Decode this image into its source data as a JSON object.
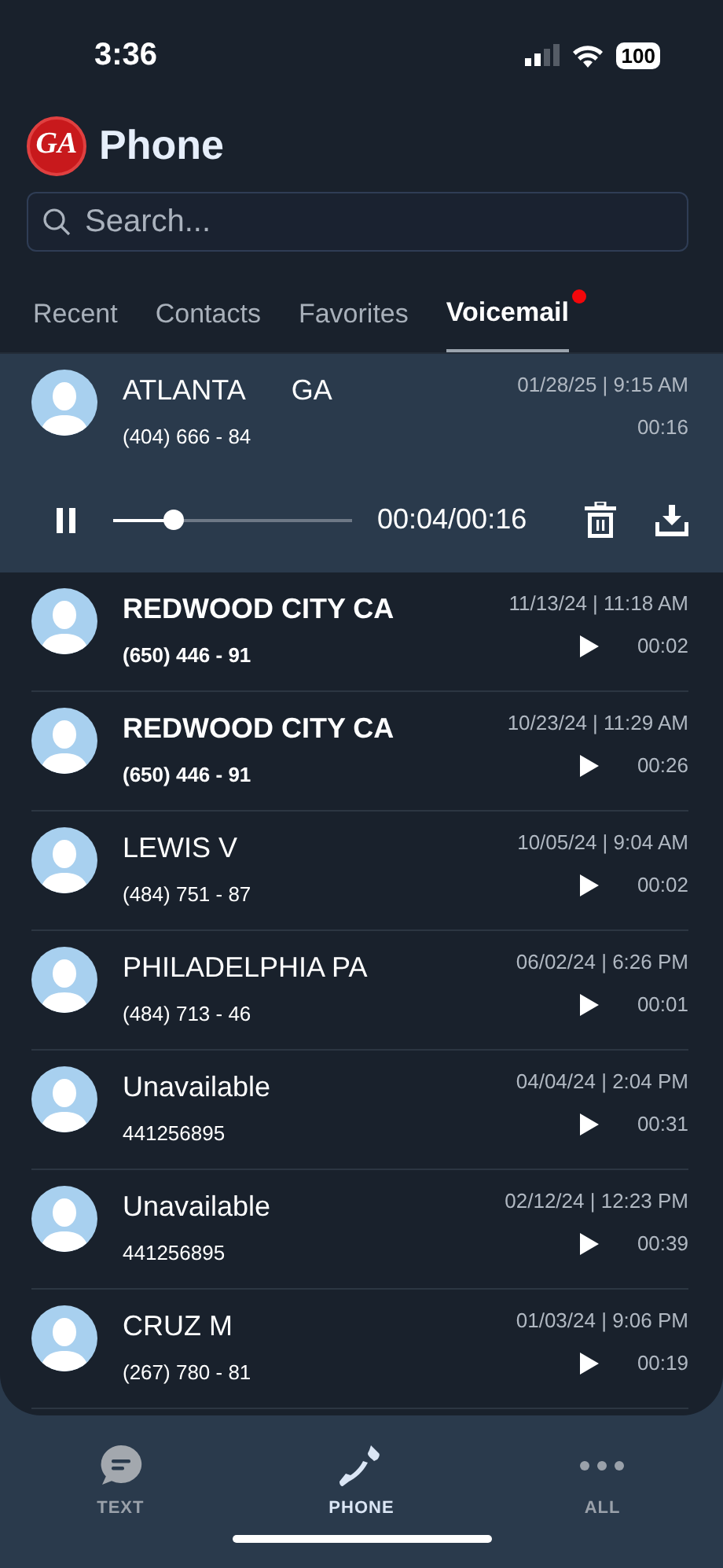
{
  "status_bar": {
    "time": "3:36",
    "battery": "100"
  },
  "header": {
    "logo": "GA",
    "title": "Phone"
  },
  "search": {
    "placeholder": "Search..."
  },
  "tabs": [
    {
      "label": "Recent",
      "selected": false,
      "badge": false
    },
    {
      "label": "Contacts",
      "selected": false,
      "badge": false
    },
    {
      "label": "Favorites",
      "selected": false,
      "badge": false
    },
    {
      "label": "Voicemail",
      "selected": true,
      "badge": true
    }
  ],
  "voicemails": [
    {
      "name": "ATLANTA      GA",
      "number": "(404) 666 - 84",
      "date_time": "01/28/25 | 9:15 AM",
      "duration": "00:16",
      "unread": false,
      "expanded": true,
      "player": {
        "level": 0.25,
        "position": "00:04/00:16",
        "playing": true
      }
    },
    {
      "name": "REDWOOD CITY CA",
      "number": "(650) 446 - 91",
      "date_time": "11/13/24 | 11:18 AM",
      "duration": "00:02",
      "unread": true,
      "expanded": false
    },
    {
      "name": "REDWOOD CITY CA",
      "number": "(650) 446 - 91",
      "date_time": "10/23/24 | 11:29 AM",
      "duration": "00:26",
      "unread": true,
      "expanded": false
    },
    {
      "name": "LEWIS V",
      "number": "(484) 751 - 87",
      "date_time": "10/05/24 | 9:04 AM",
      "duration": "00:02",
      "unread": false,
      "expanded": false
    },
    {
      "name": "PHILADELPHIA PA",
      "number": "(484) 713 - 46",
      "date_time": "06/02/24 | 6:26 PM",
      "duration": "00:01",
      "unread": false,
      "expanded": false
    },
    {
      "name": "Unavailable",
      "number": "441256895",
      "date_time": "04/04/24 | 2:04 PM",
      "duration": "00:31",
      "unread": false,
      "expanded": false
    },
    {
      "name": "Unavailable",
      "number": "441256895",
      "date_time": "02/12/24 | 12:23 PM",
      "duration": "00:39",
      "unread": false,
      "expanded": false
    },
    {
      "name": "CRUZ M",
      "number": "(267) 780 - 81",
      "date_time": "01/03/24 | 9:06 PM",
      "duration": "00:19",
      "unread": false,
      "expanded": false
    }
  ],
  "bottom_nav": [
    {
      "label": "TEXT",
      "kind": "text",
      "selected": false
    },
    {
      "label": "PHONE",
      "kind": "phone",
      "selected": true
    },
    {
      "label": "ALL",
      "kind": "all",
      "selected": false
    }
  ]
}
